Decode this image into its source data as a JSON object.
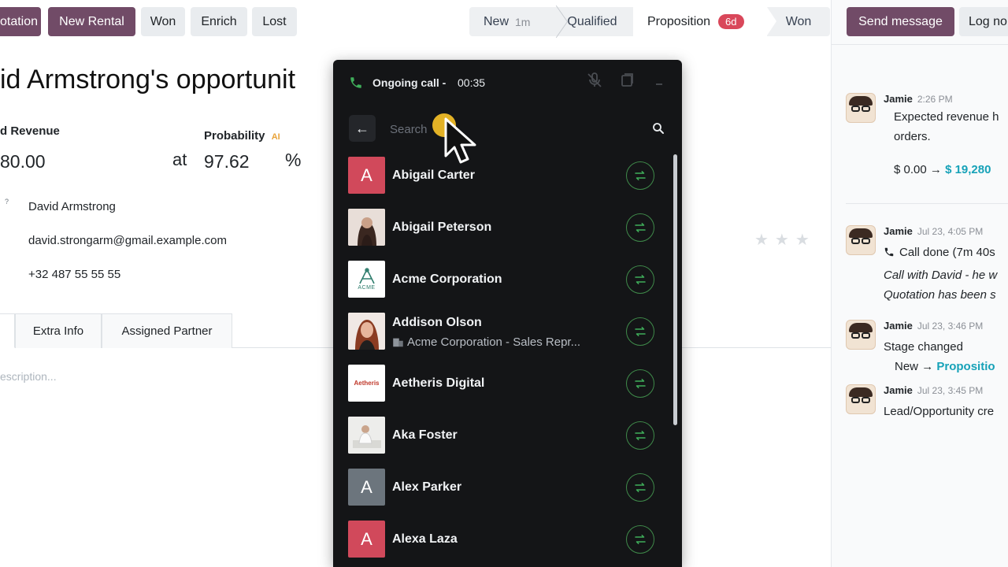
{
  "toolbar": {
    "buttons": [
      "otation",
      "New Rental",
      "Won",
      "Enrich",
      "Lost"
    ],
    "stages": [
      {
        "label": "New",
        "sub": "1m"
      },
      {
        "label": "Qualified"
      },
      {
        "label": "Proposition",
        "badge": "6d"
      },
      {
        "label": "Won"
      }
    ]
  },
  "form": {
    "title": "id Armstrong's opportunit",
    "revenue_label": "d Revenue",
    "revenue_value": "80.00",
    "at": "at",
    "probability_label": "Probability",
    "probability_ai": "AI",
    "probability_value": "97.62",
    "percent": "%",
    "contact_mark": "?",
    "contact_name": "David Armstrong",
    "email": "david.strongarm@gmail.example.com",
    "phone": "+32 487 55 55 55",
    "stars": "★★★",
    "tabs": [
      "Extra Info",
      "Assigned Partner"
    ],
    "description_placeholder": "escription..."
  },
  "chatter": {
    "send_message": "Send message",
    "log_note": "Log no",
    "messages": [
      {
        "author": "Jamie",
        "time": "2:26 PM",
        "line1": "Expected revenue h",
        "line2": "orders.",
        "from": "$ 0.00",
        "arrow": "→",
        "to": "$ 19,280"
      },
      {
        "author": "Jamie",
        "time": "Jul 23, 4:05 PM",
        "line1": "Call done (7m 40s",
        "line2": "Call with David - he w",
        "line3": "Quotation has been s"
      },
      {
        "author": "Jamie",
        "time": "Jul 23, 3:46 PM",
        "line1": "Stage changed",
        "from": "New",
        "arrow": "→",
        "to": "Propositio"
      },
      {
        "author": "Jamie",
        "time": "Jul 23, 3:45 PM",
        "line1": "Lead/Opportunity cre"
      }
    ]
  },
  "call": {
    "title": "Ongoing call -",
    "timer": "00:35",
    "search_placeholder": "Search",
    "contacts": [
      {
        "name": "Abigail Carter",
        "letter": "A",
        "color": "#d1495b"
      },
      {
        "name": "Abigail Peterson",
        "photo": true
      },
      {
        "name": "Acme Corporation",
        "logo": "ACME"
      },
      {
        "name": "Addison Olson",
        "sub": "Acme Corporation - Sales Repr...",
        "photo": true
      },
      {
        "name": "Aetheris Digital",
        "logo": "Aetheris"
      },
      {
        "name": "Aka Foster",
        "photo": true
      },
      {
        "name": "Alex Parker",
        "letter": "A",
        "color": "#6c757d"
      },
      {
        "name": "Alexa Laza",
        "letter": "A",
        "color": "#d1495b"
      }
    ]
  },
  "colors": {
    "primary": "#714b67",
    "panel": "#141517",
    "accent_green": "#3f8a4a",
    "teal": "#17a2b8"
  }
}
